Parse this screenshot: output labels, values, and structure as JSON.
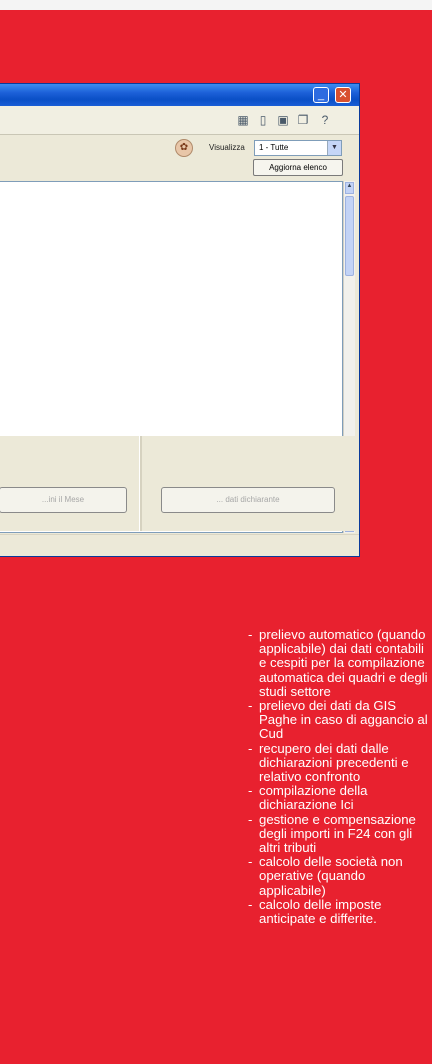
{
  "window": {
    "visualizza_label": "Visualizza",
    "filter_value": "1 - Tutte",
    "refresh_button": "Aggiorna elenco",
    "left_button": "...ini il Mese",
    "right_button": "... dati dichiarante"
  },
  "features": [
    "prelievo automatico (quando applicabile) dai dati contabili e cespiti per la compilazione automatica dei quadri e degli studi settore",
    "prelievo dei dati da GIS Paghe in caso di aggancio al Cud",
    "recupero dei dati dalle dichiarazioni precedenti e relativo confronto",
    "compilazione della dichiarazione Ici",
    "gestione e compensazione degli importi in F24 con gli altri tributi",
    "calcolo delle società non operative (quando applicabile)",
    "calcolo delle imposte anticipate e differite."
  ],
  "colors": {
    "background": "#e8212f",
    "titlebar": "#1c60d8"
  }
}
